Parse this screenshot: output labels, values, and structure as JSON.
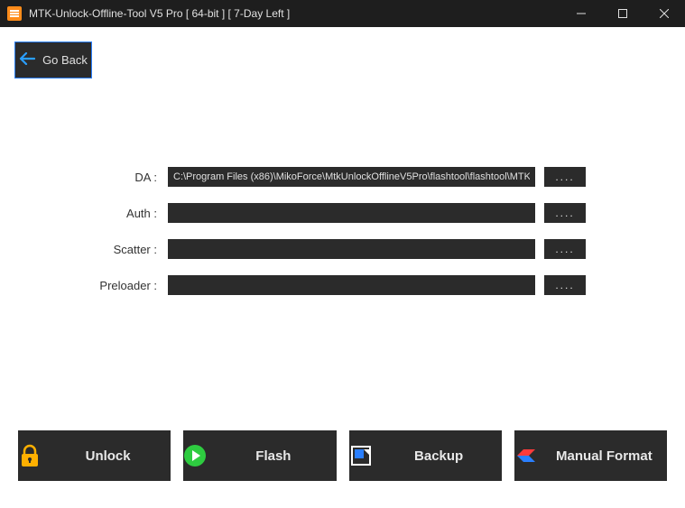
{
  "title": "MTK-Unlock-Offline-Tool V5 Pro [ 64-bit ]    [ 7-Day  Left  ]",
  "goBack": "Go Back",
  "browse": "....",
  "fields": {
    "da": {
      "label": "DA :",
      "value": "C:\\Program Files (x86)\\MikoForce\\MtkUnlockOfflineV5Pro\\flashtool\\flashtool\\MTK"
    },
    "auth": {
      "label": "Auth :",
      "value": ""
    },
    "scatter": {
      "label": "Scatter :",
      "value": ""
    },
    "preloader": {
      "label": "Preloader :",
      "value": ""
    }
  },
  "actions": {
    "unlock": "Unlock",
    "flash": "Flash",
    "backup": "Backup",
    "manual": "Manual Format"
  }
}
